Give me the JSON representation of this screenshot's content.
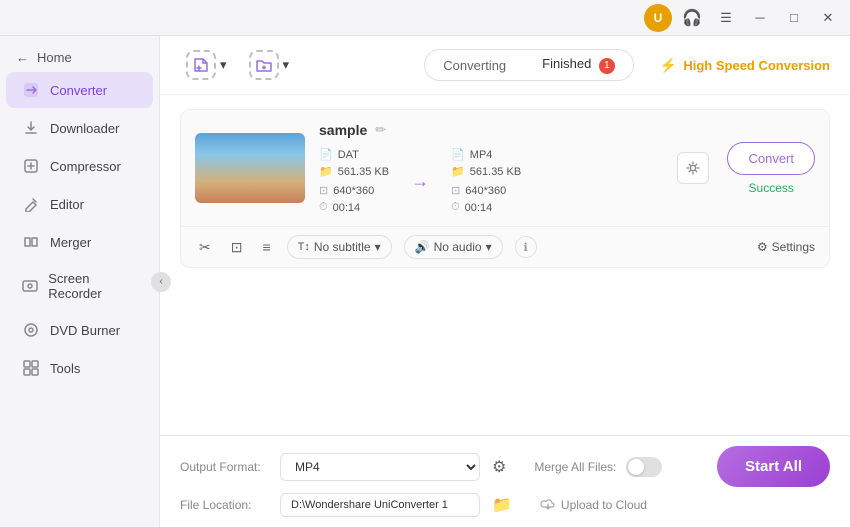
{
  "titlebar": {
    "minimize": "─",
    "maximize": "□",
    "close": "✕",
    "user_initials": "U"
  },
  "sidebar": {
    "home_label": "Home",
    "items": [
      {
        "id": "converter",
        "label": "Converter",
        "icon": "⟳",
        "active": true
      },
      {
        "id": "downloader",
        "label": "Downloader",
        "icon": "↓"
      },
      {
        "id": "compressor",
        "label": "Compressor",
        "icon": "⊡"
      },
      {
        "id": "editor",
        "label": "Editor",
        "icon": "✂"
      },
      {
        "id": "merger",
        "label": "Merger",
        "icon": "⊞"
      },
      {
        "id": "screen-recorder",
        "label": "Screen Recorder",
        "icon": "⏺"
      },
      {
        "id": "dvd-burner",
        "label": "DVD Burner",
        "icon": "💿"
      },
      {
        "id": "tools",
        "label": "Tools",
        "icon": "⊞"
      }
    ]
  },
  "toolbar": {
    "add_file_label": "Add Files",
    "add_folder_label": "Add Folder",
    "tab_converting": "Converting",
    "tab_finished": "Finished",
    "finished_badge": "1",
    "speed_label": "High Speed Conversion"
  },
  "file": {
    "name": "sample",
    "source": {
      "format": "DAT",
      "resolution": "640*360",
      "size": "561.35 KB",
      "duration": "00:14"
    },
    "target": {
      "format": "MP4",
      "resolution": "640*360",
      "size": "561.35 KB",
      "duration": "00:14"
    },
    "subtitle_label": "No subtitle",
    "audio_label": "No audio",
    "settings_label": "Settings",
    "convert_btn": "Convert",
    "status": "Success"
  },
  "bottom": {
    "output_format_label": "Output Format:",
    "output_format_value": "MP4",
    "file_location_label": "File Location:",
    "file_location_value": "D:\\Wondershare UniConverter 1",
    "merge_label": "Merge All Files:",
    "upload_cloud_label": "Upload to Cloud",
    "start_all_label": "Start All"
  }
}
